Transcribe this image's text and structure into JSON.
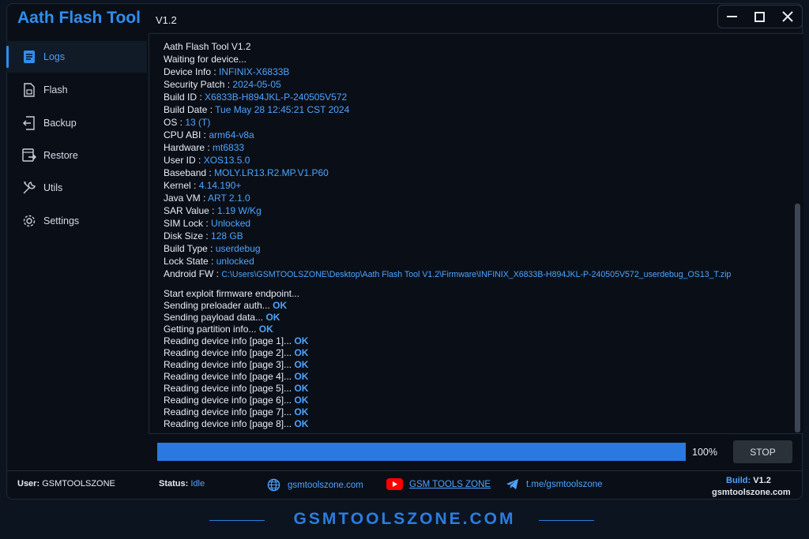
{
  "app": {
    "title": "Aath Flash Tool",
    "version": "V1.2"
  },
  "sidebar": {
    "items": [
      {
        "label": "Logs",
        "icon": "document-icon",
        "active": true
      },
      {
        "label": "Flash",
        "icon": "chip-file-icon"
      },
      {
        "label": "Backup",
        "icon": "backup-icon"
      },
      {
        "label": "Restore",
        "icon": "restore-icon"
      },
      {
        "label": "Utils",
        "icon": "tools-icon"
      },
      {
        "label": "Settings",
        "icon": "gear-icon"
      }
    ]
  },
  "log": {
    "header": "Aath Flash Tool  V1.2",
    "waiting": "Waiting for device...",
    "device": [
      {
        "key": "Device Info :",
        "value": "INFINIX-X6833B"
      },
      {
        "key": "Security Patch :",
        "value": "2024-05-05"
      },
      {
        "key": "Build ID :",
        "value": "X6833B-H894JKL-P-240505V572"
      },
      {
        "key": "Build Date :",
        "value": "Tue May 28 12:45:21 CST 2024"
      },
      {
        "key": "OS :",
        "value": "13 (T)"
      },
      {
        "key": "CPU ABI :",
        "value": "arm64-v8a"
      },
      {
        "key": "Hardware :",
        "value": "mt6833"
      },
      {
        "key": "User ID :",
        "value": "XOS13.5.0"
      },
      {
        "key": "Baseband :",
        "value": "MOLY.LR13.R2.MP.V1.P60"
      },
      {
        "key": "Kernel :",
        "value": "4.14.190+"
      },
      {
        "key": "Java VM :",
        "value": "ART 2.1.0"
      },
      {
        "key": "SAR Value :",
        "value": "1.19 W/Kg"
      },
      {
        "key": "SIM Lock :",
        "value": "Unlocked"
      },
      {
        "key": "Disk Size :",
        "value": "128 GB"
      },
      {
        "key": "Build Type :",
        "value": "userdebug"
      },
      {
        "key": "Lock State :",
        "value": "unlocked"
      }
    ],
    "android_fw_key": "Android FW :",
    "android_fw_value": "C:\\Users\\GSMTOOLSZONE\\Desktop\\Aath Flash Tool V1.2\\Firmware\\INFINIX_X6833B-H894JKL-P-240505V572_userdebug_OS13_T.zip",
    "start_line": "Start exploit firmware endpoint...",
    "steps": [
      {
        "text": "Sending preloader auth...",
        "status": "OK"
      },
      {
        "text": "Sending payload data...",
        "status": "OK"
      },
      {
        "text": "Getting partition info...",
        "status": "OK"
      },
      {
        "text": "Reading device info [page 1]...",
        "status": "OK"
      },
      {
        "text": "Reading device info [page 2]...",
        "status": "OK"
      },
      {
        "text": "Reading device info [page 3]...",
        "status": "OK"
      },
      {
        "text": "Reading device info [page 4]...",
        "status": "OK"
      },
      {
        "text": "Reading device info [page 5]...",
        "status": "OK"
      },
      {
        "text": "Reading device info [page 6]...",
        "status": "OK"
      },
      {
        "text": "Reading device info [page 7]...",
        "status": "OK"
      },
      {
        "text": "Reading device info [page 8]...",
        "status": "OK"
      }
    ]
  },
  "progress": {
    "value": 1.0,
    "label": "100%"
  },
  "stop_button": "STOP",
  "status_bar": {
    "user_label": "User:",
    "user_value": "GSMTOOLSZONE",
    "status_label": "Status:",
    "status_value": "Idle",
    "website": "gsmtoolszone.com",
    "youtube": "GSM TOOLS ZONE",
    "telegram": "t.me/gsmtoolszone",
    "build_label": "Build:",
    "build_value": "V1.2",
    "build_site": "gsmtoolszone.com"
  },
  "footer": {
    "brand": "GSMTOOLSZONE.COM"
  },
  "colors": {
    "accent": "#2f8ef0",
    "value_text": "#4ea3ff",
    "background": "#0a0f17",
    "youtube_red": "#ff0000"
  }
}
